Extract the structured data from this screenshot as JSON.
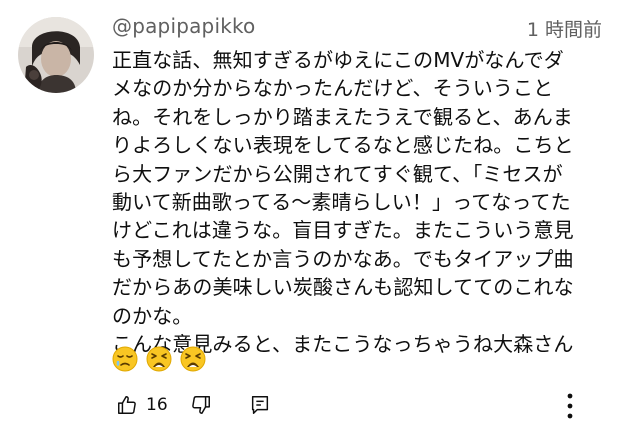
{
  "comment": {
    "username": "@papipapikko",
    "time": "1 時間前",
    "lines": [
      "正直な話、無知すぎるがゆえにこのMVがなんでダ",
      "メなのか分からなかったんだけど、そういうこと",
      "ね。それをしっかり踏まえたうえで観ると、あんま",
      "りよろしくない表現をしてるなと感じたね。こちと",
      "ら大ファンだから公開されてすぐ観て、「ミセスが",
      "動いて新曲歌ってる～素晴らしい！」ってなってた",
      "けどこれは違うな。盲目すぎた。またこういう意見",
      "も予想してたとか言うのかなあ。でもタイアップ曲",
      "だからあの美味しい炭酸さんも認知しててのこれな",
      "のかな。",
      "こんな意見みると、またこうなっちゃうね大森さん"
    ],
    "emojis": [
      "sleepy-face-icon",
      "weary-face-icon",
      "weary-face-icon"
    ],
    "like_count": "16"
  },
  "colors": {
    "meta": "#606060",
    "text": "#0f0f0f",
    "emoji": "#f9c623"
  }
}
